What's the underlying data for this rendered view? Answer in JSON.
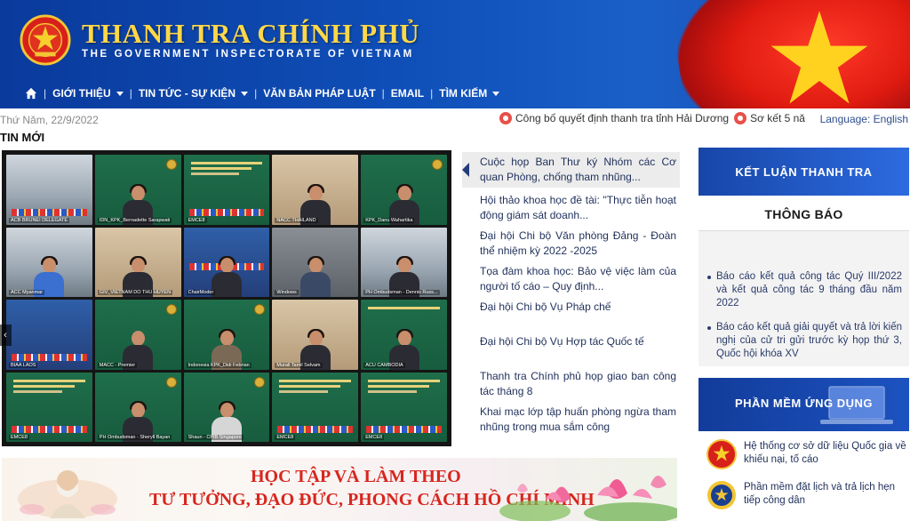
{
  "header": {
    "title": "THANH TRA CHÍNH PHỦ",
    "subtitle": "THE GOVERNMENT INSPECTORATE OF VIETNAM",
    "nav": [
      {
        "label": "GIỚI THIỆU",
        "dropdown": true
      },
      {
        "label": "TIN TỨC - SỰ KIỆN",
        "dropdown": true
      },
      {
        "label": "VĂN BẢN PHÁP LUẬT",
        "dropdown": false
      },
      {
        "label": "EMAIL",
        "dropdown": false
      },
      {
        "label": "TÌM KIẾM",
        "dropdown": true
      }
    ],
    "colors": {
      "brand_blue": "#0f4fb8",
      "title_gold": "#ffd84a",
      "flag_red": "#e01b10"
    }
  },
  "info_bar": {
    "date": "Thứ Năm, 22/9/2022",
    "ticker": [
      "Công bố quyết định thanh tra tỉnh Hải Dương",
      "Sơ kết 5 nă"
    ],
    "language_label": "Language: English"
  },
  "section_title": "TIN MỚI",
  "video": {
    "tiles": [
      "ACB BRUNEI DELEGATE",
      "IDN_KPK_Bernadette Sarapwati",
      "EMCE8",
      "NACC THAILAND",
      "KPK_Danu Wahartika",
      "ACC Myanmar",
      "GIV_VIETNAM DO THU HUYEN",
      "ChairModer",
      "Windows",
      "PH Ombudsman - Dennis Russ...",
      "BIAA LAOS",
      "MACC - Premier",
      "Indonesia KPK_Didi Febrian",
      "Murali Tamil Selvam",
      "ACU CAMBODIA",
      "EMCE8",
      "PH Ombudsman - Sheryll Bayan",
      "Shaun - CPIB Singapore",
      "EMCE8",
      "EMCE8"
    ]
  },
  "news": [
    "Cuộc họp Ban Thư ký Nhóm các Cơ quan Phòng, chống tham nhũng...",
    "Hội thảo khoa học đề tài: \"Thực tiễn hoạt động giám sát doanh...",
    "Đại hội Chi bộ Văn phòng Đảng - Đoàn thể nhiệm kỳ 2022 -2025",
    "Tọa đàm khoa học: Bảo vệ việc làm của người tố cáo – Quy định...",
    "Đại hội Chi bộ Vụ Pháp chế",
    "Đại hội Chi bộ Vụ Hợp tác Quốc tế",
    "Thanh tra Chính phủ họp giao ban công tác tháng 8",
    "Khai mạc lớp tập huấn phòng ngừa tham nhũng trong mua sắm công"
  ],
  "banner": {
    "line1": "HỌC TẬP VÀ LÀM THEO",
    "line2": "TƯ TƯỞNG, ĐẠO ĐỨC, PHONG CÁCH HỒ CHÍ MINH"
  },
  "right": {
    "ket_luan": "KẾT LUẬN THANH TRA",
    "thong_bao_title": "THÔNG BÁO",
    "thong_bao": [
      "Báo cáo kết quả công tác Quý III/2022 và kết quả công tác 9 tháng đầu năm 2022",
      "Báo cáo kết quả giải quyết và trả lời kiến nghị của cử tri gửi trước kỳ họp thứ 3, Quốc hội khóa XV"
    ],
    "phan_mem_title": "PHẦN MỀM ỨNG DỤNG",
    "apps": [
      "Hệ thống cơ sở dữ liệu Quốc gia về khiếu nại, tố cáo",
      "Phần mềm đặt lịch và trả lịch hẹn tiếp công dân"
    ]
  }
}
